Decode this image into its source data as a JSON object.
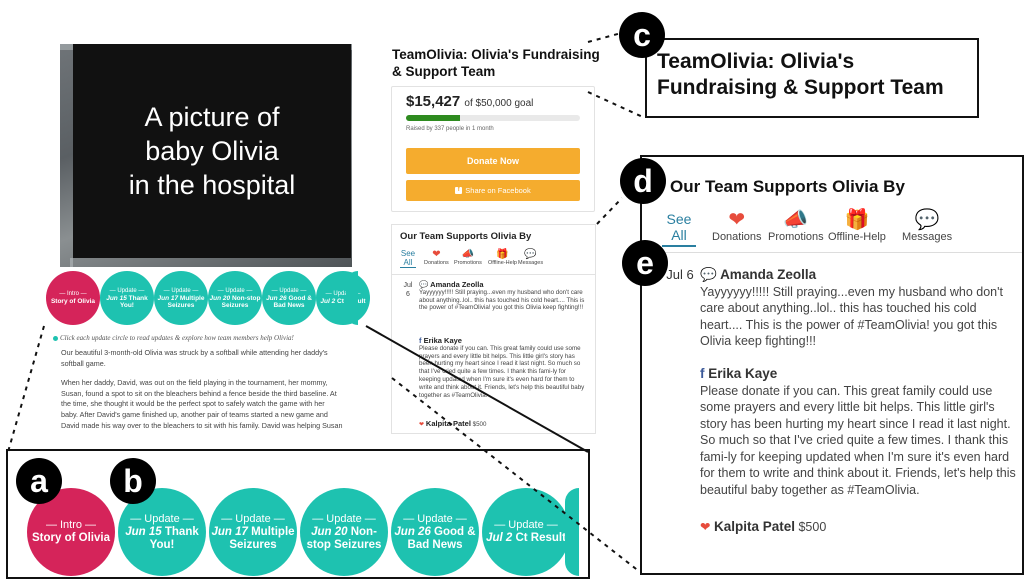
{
  "hero": {
    "caption": "A picture of\nbaby Olivia\nin the hospital"
  },
  "story_circles": [
    {
      "top": "— Intro —",
      "date": "",
      "title": "Story of Olivia",
      "kind": "intro"
    },
    {
      "top": "— Update —",
      "date": "Jun 15",
      "title": "Thank You!",
      "kind": "update"
    },
    {
      "top": "— Update —",
      "date": "Jun 17",
      "title": "Multiple Seizures",
      "kind": "update"
    },
    {
      "top": "— Update —",
      "date": "Jun 20",
      "title": "Non-stop Seizures",
      "kind": "update"
    },
    {
      "top": "— Update —",
      "date": "Jun 26",
      "title": "Good & Bad News",
      "kind": "update"
    },
    {
      "top": "— Update —",
      "date": "Jul 2",
      "title": "Ct Result",
      "kind": "update"
    }
  ],
  "story": {
    "hint": "Click each update circle to read updates & explore how team members help Olivia!",
    "paragraphs": [
      "Our beautiful 3-month-old Olivia was struck by a softball while attending her daddy's softball game.",
      "When her daddy, David, was out on the field playing in the tournament, her mommy, Susan, found a spot to sit on the bleachers behind a fence beside the third baseline. At the time, she thought it would be the perfect spot to safely watch the game with her baby. After David's game finished up, another pair of teams started a new game and David made his way over to the bleachers to sit with his family. David was helping Susan get"
    ]
  },
  "team": {
    "title": "TeamOlivia: Olivia's Fundraising & Support Team"
  },
  "fundraising": {
    "raised": "$15,427",
    "goal_text": "of $50,000 goal",
    "progress_fraction": 0.31,
    "raised_by": "Raised by 337 people in 1 month",
    "donate_label": "Donate Now",
    "share_label": "Share on Facebook"
  },
  "supports": {
    "heading": "Our Team Supports Olivia By",
    "see_all": "See All",
    "tabs": [
      {
        "label": "Donations",
        "icon": "heart-icon",
        "glyph": "❤",
        "color": "#e74c3c"
      },
      {
        "label": "Promotions",
        "icon": "megaphone-icon",
        "glyph": "📣",
        "color": "#3b7fb0"
      },
      {
        "label": "Offline-Help",
        "icon": "gift-icon",
        "glyph": "🎁",
        "color": "#7cb342"
      },
      {
        "label": "Messages",
        "icon": "chat-bubble-icon",
        "glyph": "💬",
        "color": "#7b4fa0"
      }
    ],
    "date": "Jul 6",
    "posts": [
      {
        "name": "Amanda Zeolla",
        "icon": "chat-bubble-icon",
        "glyph": "💬",
        "color": "#7b4fa0",
        "text": "Yayyyyyy!!!!! Still praying...even my husband who don't care about anything..lol.. this has touched his cold heart.... This is the power of #TeamOlivia! you got this Olivia keep fighting!!!"
      },
      {
        "name": "Erika Kaye",
        "icon": "facebook-icon",
        "glyph": "f",
        "color": "#3b5998",
        "text": "Please donate if you can. This great family could use some prayers and every little bit helps. This little girl's story has been hurting my heart since I read it last night. So much so that I've cried quite a few times. I thank this fami-ly for keeping updated when I'm sure it's even hard for them to write and think about it. Friends, let's help this beautiful baby together as #TeamOlivia."
      },
      {
        "name": "Kalpita Patel",
        "icon": "heart-icon",
        "glyph": "❤",
        "color": "#e74c3c",
        "amount": "$500",
        "text": ""
      }
    ]
  },
  "callouts": {
    "a": "a",
    "b": "b",
    "c": "c",
    "d": "d",
    "e": "e"
  }
}
